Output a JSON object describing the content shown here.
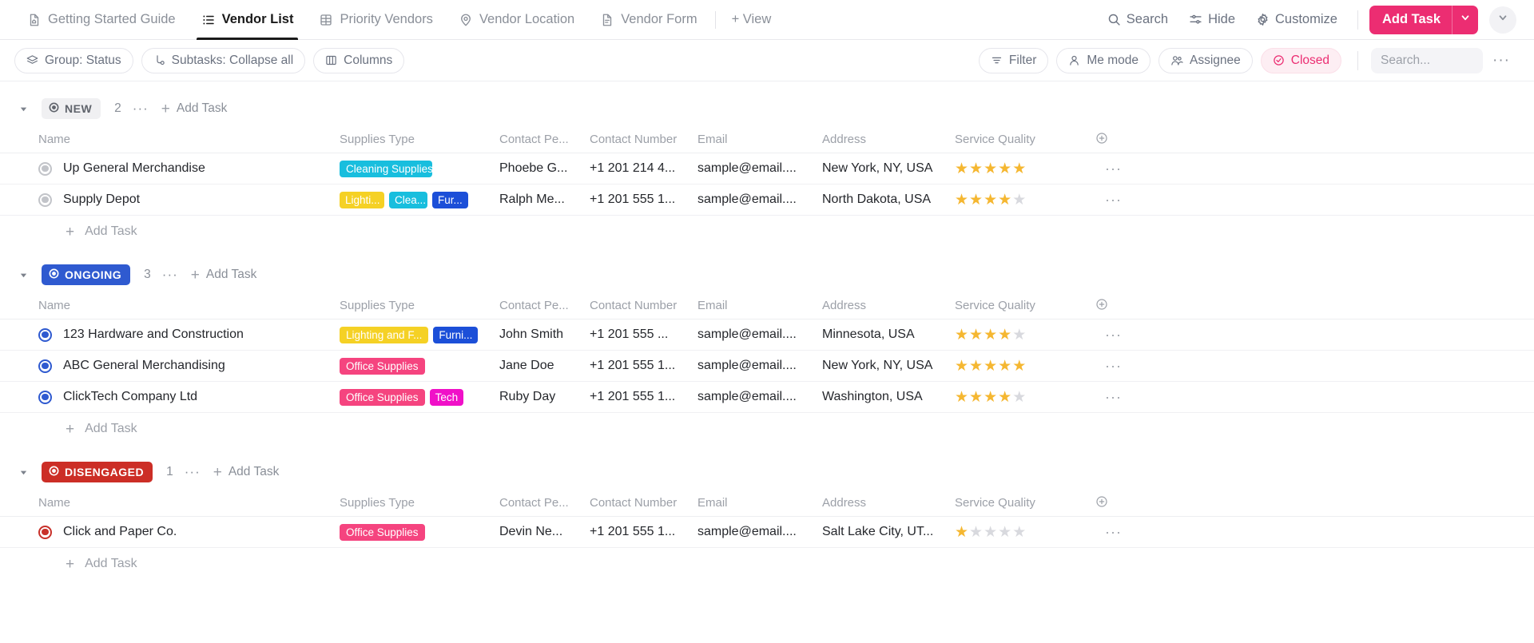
{
  "tabs": [
    {
      "label": "Getting Started Guide",
      "icon": "doc-home-icon",
      "active": false
    },
    {
      "label": "Vendor List",
      "icon": "list-icon",
      "active": true
    },
    {
      "label": "Priority Vendors",
      "icon": "table-icon",
      "active": false
    },
    {
      "label": "Vendor Location",
      "icon": "map-pin-icon",
      "active": false
    },
    {
      "label": "Vendor Form",
      "icon": "form-icon",
      "active": false
    }
  ],
  "add_view_label": "+ View",
  "toolbar": {
    "search_label": "Search",
    "hide_label": "Hide",
    "customize_label": "Customize",
    "add_task_label": "Add Task",
    "accent_color": "#ec2d72"
  },
  "filterbar": {
    "group_label": "Group: Status",
    "subtasks_label": "Subtasks: Collapse all",
    "columns_label": "Columns",
    "filter_label": "Filter",
    "me_mode_label": "Me mode",
    "assignee_label": "Assignee",
    "closed_label": "Closed",
    "search_placeholder": "Search...",
    "search_value": "",
    "more_label": "···"
  },
  "columns": [
    "Name",
    "Supplies Type",
    "Contact Pe...",
    "Contact Number",
    "Email",
    "Address",
    "Service Quality"
  ],
  "add_task_label": "Add Task",
  "groups": [
    {
      "status": "NEW",
      "color": "#6b7280",
      "chip_bg": "#f0f0f2",
      "chip_fg": "#60646c",
      "dot_class": "",
      "count": "2",
      "add_task_label": "Add Task",
      "rows": [
        {
          "name": "Up General Merchandise",
          "tags": [
            {
              "label": "Cleaning Supplies",
              "color": "#18bede",
              "size": ""
            }
          ],
          "contact_person": "Phoebe G...",
          "contact_number": "+1 201 214 4...",
          "email": "sample@email....",
          "address": "New York, NY, USA",
          "rating": 5
        },
        {
          "name": "Supply Depot",
          "tags": [
            {
              "label": "Lighti...",
              "color": "#f5d125",
              "size": "sm"
            },
            {
              "label": "Clea...",
              "color": "#18bede",
              "size": "xs"
            },
            {
              "label": "Fur...",
              "color": "#1c4fd8",
              "size": "xs"
            }
          ],
          "contact_person": "Ralph Me...",
          "contact_number": "+1 201 555 1...",
          "email": "sample@email....",
          "address": "North Dakota, USA",
          "rating": 4
        }
      ]
    },
    {
      "status": "ONGOING",
      "color": "#2f5ad0",
      "chip_bg": "#2f5ad0",
      "chip_fg": "#ffffff",
      "dot_class": "blue",
      "count": "3",
      "add_task_label": "Add Task",
      "rows": [
        {
          "name": "123 Hardware and Construction",
          "tags": [
            {
              "label": "Lighting and F...",
              "color": "#f5d125",
              "size": ""
            },
            {
              "label": "Furni...",
              "color": "#1c4fd8",
              "size": "sm"
            }
          ],
          "contact_person": "John Smith",
          "contact_number": "+1 201 555 ...",
          "email": "sample@email....",
          "address": "Minnesota, USA",
          "rating": 4
        },
        {
          "name": "ABC General Merchandising",
          "tags": [
            {
              "label": "Office Supplies",
              "color": "#f5447f",
              "size": ""
            }
          ],
          "contact_person": "Jane Doe",
          "contact_number": "+1 201 555 1...",
          "email": "sample@email....",
          "address": "New York, NY, USA",
          "rating": 5
        },
        {
          "name": "ClickTech Company Ltd",
          "tags": [
            {
              "label": "Office Supplies",
              "color": "#f5447f",
              "size": ""
            },
            {
              "label": "Tech",
              "color": "#f010c8",
              "size": "xs"
            }
          ],
          "contact_person": "Ruby Day",
          "contact_number": "+1 201 555 1...",
          "email": "sample@email....",
          "address": "Washington, USA",
          "rating": 4
        }
      ]
    },
    {
      "status": "DISENGAGED",
      "color": "#c8312a",
      "chip_bg": "#cc2e26",
      "chip_fg": "#ffffff",
      "dot_class": "red",
      "count": "1",
      "add_task_label": "Add Task",
      "rows": [
        {
          "name": "Click and Paper Co.",
          "tags": [
            {
              "label": "Office Supplies",
              "color": "#f5447f",
              "size": ""
            }
          ],
          "contact_person": "Devin Ne...",
          "contact_number": "+1 201 555 1...",
          "email": "sample@email....",
          "address": "Salt Lake City, UT...",
          "rating": 1
        }
      ]
    }
  ]
}
